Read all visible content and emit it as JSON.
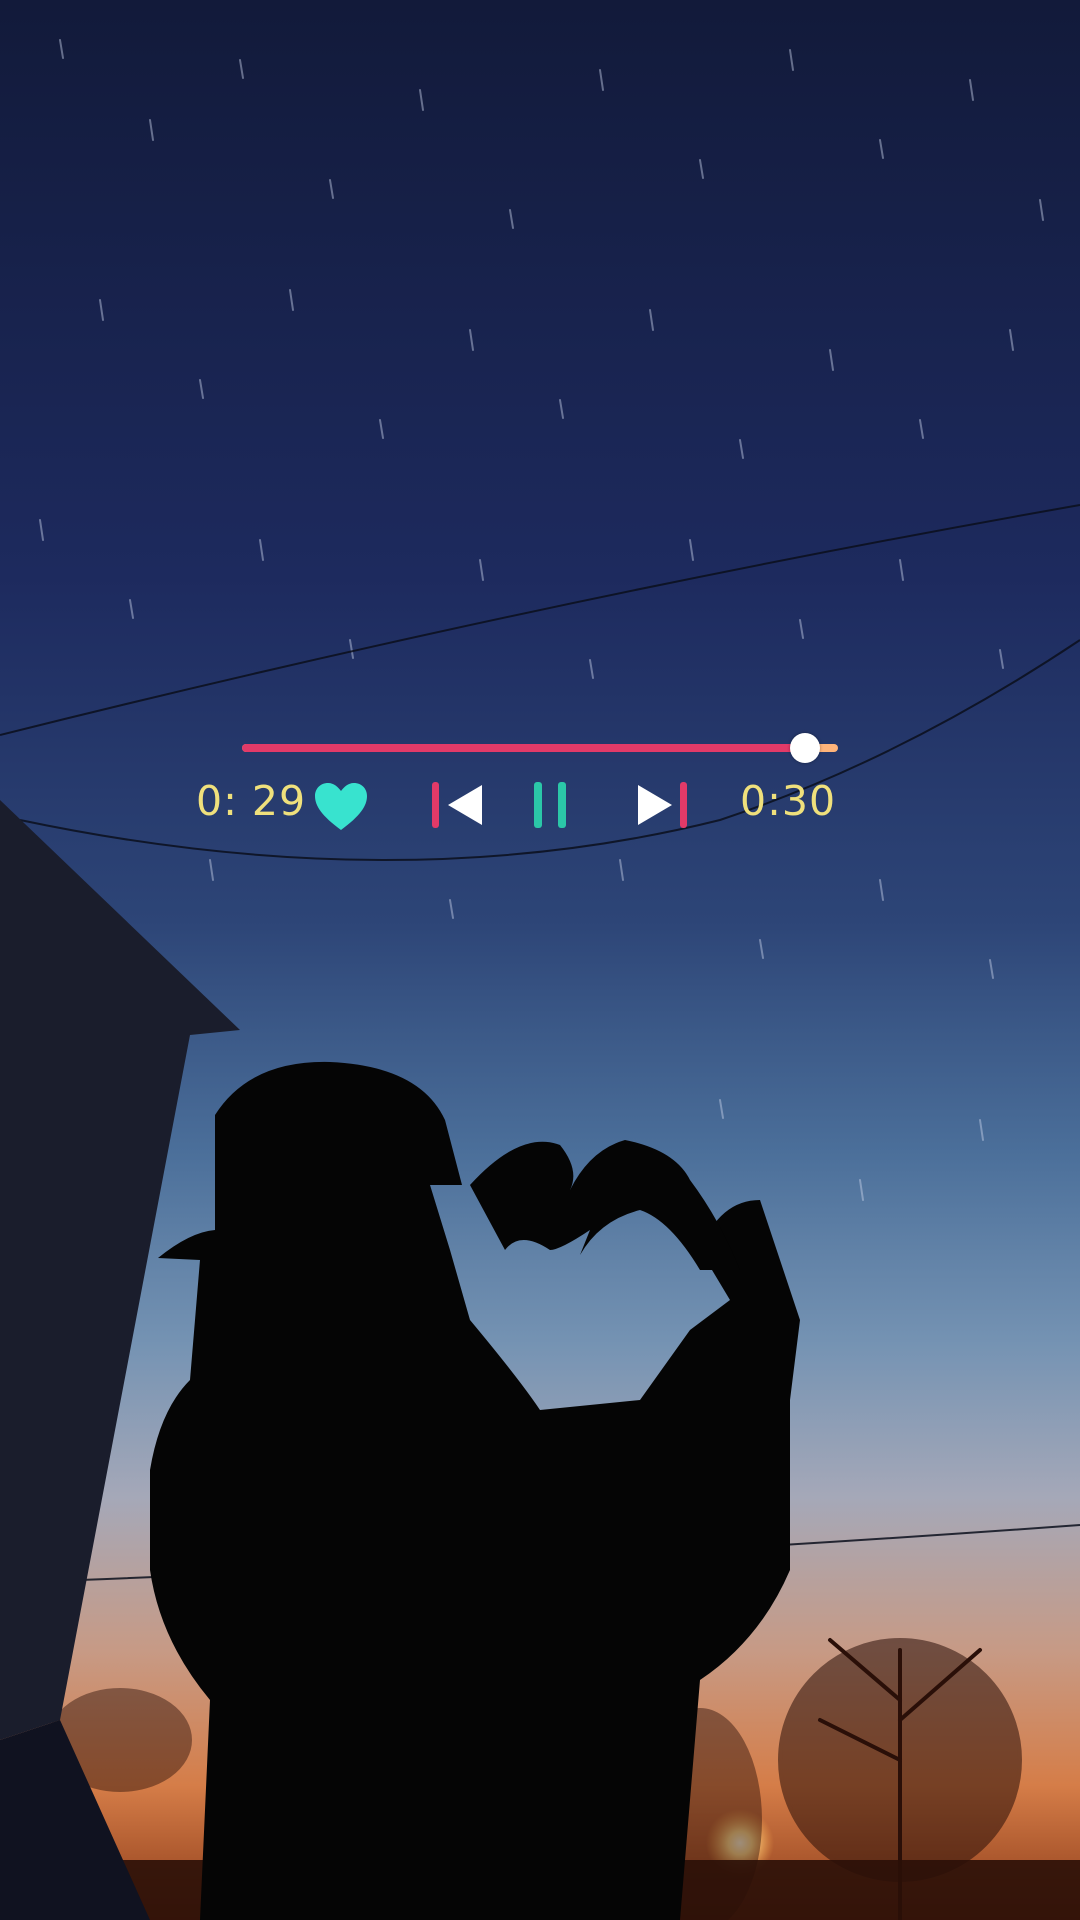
{
  "player": {
    "elapsed": "0: 29",
    "total": "0:30",
    "progress_fraction": 0.944,
    "icons": {
      "like": "heart-icon",
      "previous": "skip-previous-icon",
      "pause": "pause-icon",
      "next": "skip-next-icon"
    },
    "colors": {
      "track_played": "#e23a68",
      "track_remaining": "#ffb47a",
      "thumb": "#ffffff",
      "time_text": "#efe07c",
      "heart": "#38e3cf",
      "pause_bars": "#2bc7a8",
      "skip_bars": "#e23a68",
      "skip_triangles": "#ffffff"
    }
  }
}
